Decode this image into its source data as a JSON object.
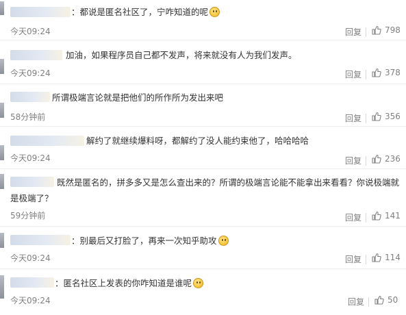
{
  "comments": [
    {
      "text": "：都说是匿名社区了，宁咋知道的呢",
      "has_emoji": true,
      "emoji_name": "thinking-emoji-icon",
      "time": "今天09:24",
      "reply": "回复",
      "likes": "798"
    },
    {
      "text": "加油，如果程序员自己都不发声，将来就没有人为我们发声。",
      "has_emoji": false,
      "time": "今天09:24",
      "reply": "回复",
      "likes": "378"
    },
    {
      "text": "所谓极端言论就是把他们的所作所为发出来吧",
      "has_emoji": false,
      "time": "58分钟前",
      "reply": "回复",
      "likes": "356"
    },
    {
      "text": "解约了就继续爆料呀，都解约了没人能约束他了，哈哈哈哈",
      "has_emoji": false,
      "time": "今天09:24",
      "reply": "回复",
      "likes": "236"
    },
    {
      "text": "既然是匿名的，拼多多又是怎么查出来的？所谓的极端言论能不能拿出来看看？你说极端就是极端了？",
      "has_emoji": false,
      "time": "59分钟前",
      "reply": "回复",
      "likes": "141"
    },
    {
      "text": "：别最后又打脸了，再来一次知乎助攻",
      "has_emoji": true,
      "emoji_name": "grin-emoji-icon",
      "time": "今天09:24",
      "reply": "回复",
      "likes": "114"
    },
    {
      "text": "：匿名社区上发表的你咋知道是谁呢",
      "has_emoji": true,
      "emoji_name": "smirk-emoji-icon",
      "time": "今天09:24",
      "reply": "回复",
      "likes": "50"
    }
  ],
  "colors": {
    "text": "#333333",
    "meta": "#808080",
    "divider": "#eeeeee"
  }
}
